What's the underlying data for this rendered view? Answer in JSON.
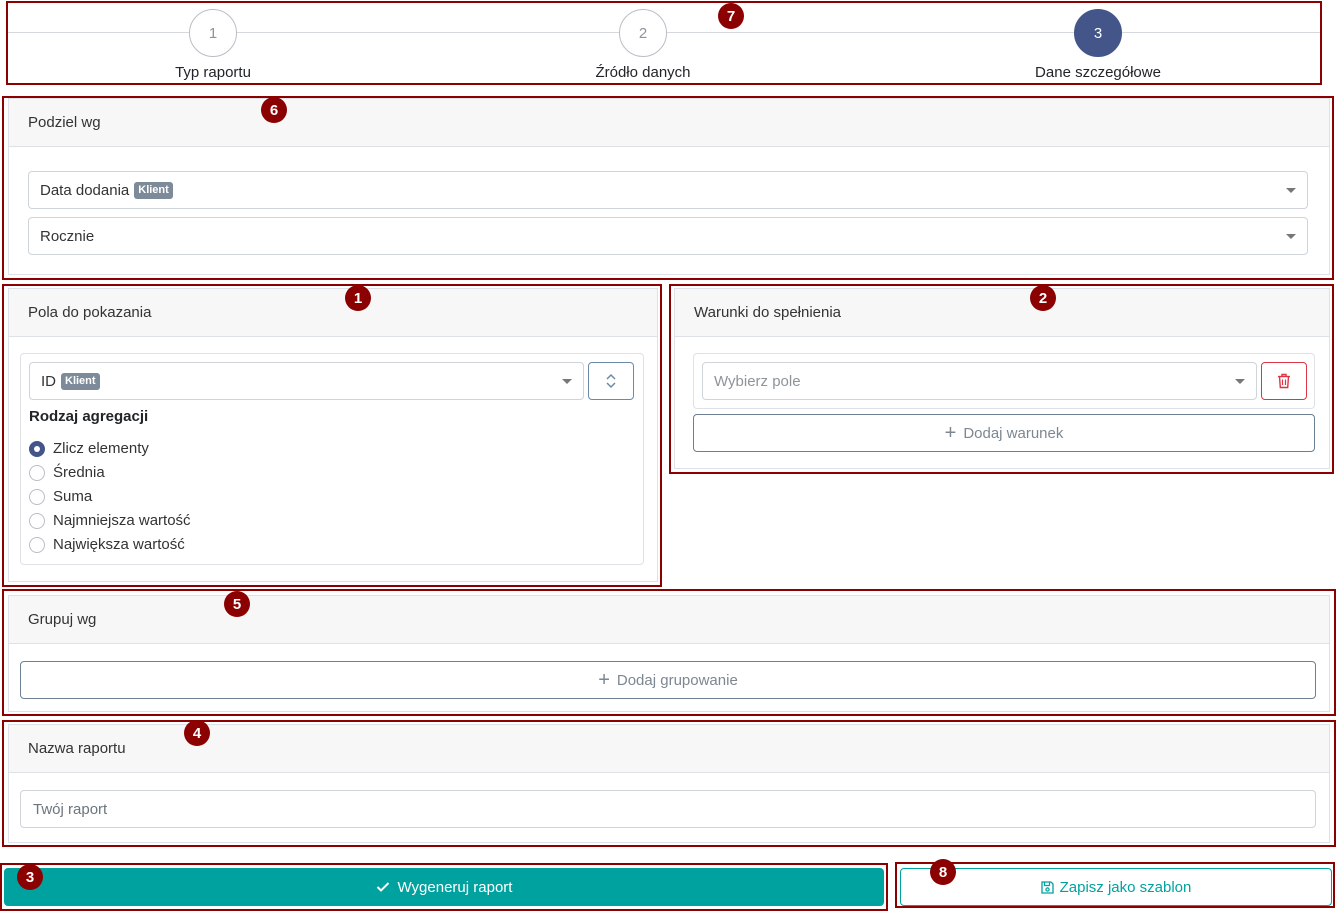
{
  "stepper": {
    "steps": [
      {
        "number": "1",
        "label": "Typ raportu"
      },
      {
        "number": "2",
        "label": "Źródło danych"
      },
      {
        "number": "3",
        "label": "Dane szczegółowe"
      }
    ]
  },
  "split_by": {
    "title": "Podziel wg",
    "field": {
      "value": "Data dodania",
      "tag": "Klient"
    },
    "period": {
      "value": "Rocznie"
    }
  },
  "fields": {
    "title": "Pola do pokazania",
    "field": {
      "value": "ID",
      "tag": "Klient"
    },
    "aggregation_title": "Rodzaj agregacji",
    "options": [
      "Zlicz elementy",
      "Średnia",
      "Suma",
      "Najmniejsza wartość",
      "Największa wartość"
    ],
    "selected": "Zlicz elementy"
  },
  "conditions": {
    "title": "Warunki do spełnienia",
    "field_placeholder": "Wybierz pole",
    "add_label": "Dodaj warunek"
  },
  "group_by": {
    "title": "Grupuj wg",
    "add_label": "Dodaj grupowanie"
  },
  "report_name": {
    "title": "Nazwa raportu",
    "placeholder": "Twój raport"
  },
  "actions": {
    "generate_label": "Wygeneruj raport",
    "save_template_label": "Zapisz jako szablon"
  },
  "annotations": [
    "1",
    "2",
    "3",
    "4",
    "5",
    "6",
    "7",
    "8"
  ],
  "colors": {
    "primary": "#00a2a0",
    "step_active": "#44558a",
    "annotation": "#8b0000",
    "danger": "#dc3545"
  }
}
